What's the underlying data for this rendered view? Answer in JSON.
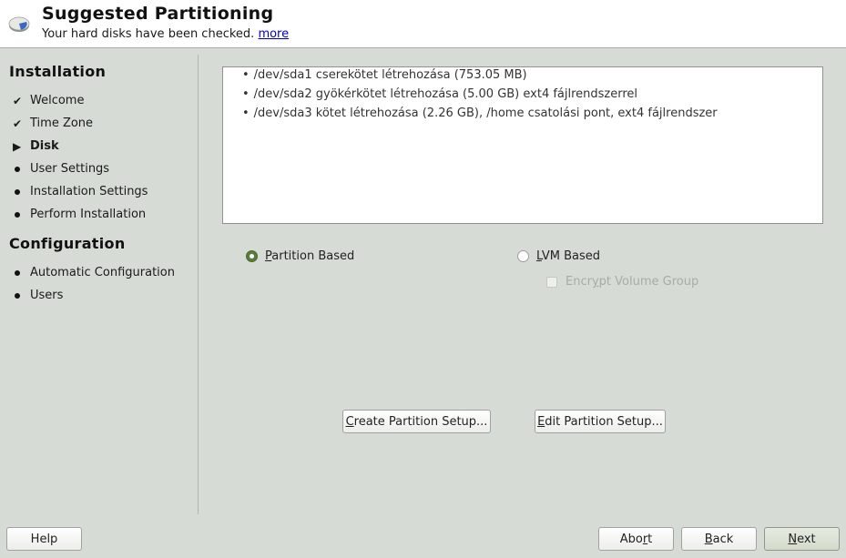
{
  "header": {
    "title": "Suggested Partitioning",
    "subtitle": "Your hard disks have been checked.",
    "more_link": "more",
    "icon": "hard-disk-icon"
  },
  "sidebar": {
    "sections": [
      {
        "title": "Installation",
        "items": [
          {
            "label": "Welcome",
            "state": "done",
            "icon": "check-icon"
          },
          {
            "label": "Time Zone",
            "state": "done",
            "icon": "check-icon"
          },
          {
            "label": "Disk",
            "state": "current",
            "icon": "arrow-right-icon"
          },
          {
            "label": "User Settings",
            "state": "pending",
            "icon": "bullet-icon"
          },
          {
            "label": "Installation Settings",
            "state": "pending",
            "icon": "bullet-icon"
          },
          {
            "label": "Perform Installation",
            "state": "pending",
            "icon": "bullet-icon"
          }
        ]
      },
      {
        "title": "Configuration",
        "items": [
          {
            "label": "Automatic Configuration",
            "state": "pending",
            "icon": "bullet-icon"
          },
          {
            "label": "Users",
            "state": "pending",
            "icon": "bullet-icon"
          }
        ]
      }
    ]
  },
  "glyphs": {
    "check": "✔",
    "arrow": "▶"
  },
  "summary": {
    "items": [
      "/dev/sda1 cserekötet létrehozása (753.05 MB)",
      "/dev/sda2 gyökérkötet létrehozása (5.00 GB) ext4 fájlrendszerrel",
      "/dev/sda3 kötet létrehozása (2.26 GB), /home csatolási pont, ext4 fájlrendszer"
    ]
  },
  "options": {
    "partition_based": {
      "mnemonic": "P",
      "rest": "artition Based",
      "checked": true
    },
    "lvm_based": {
      "mnemonic": "L",
      "rest": "VM Based",
      "checked": false
    },
    "encrypt": {
      "pre": "Encr",
      "mnemonic": "y",
      "rest": "pt Volume Group",
      "checked": false,
      "enabled": false
    }
  },
  "buttons": {
    "create": {
      "mnemonic": "C",
      "rest": "reate Partition Setup..."
    },
    "edit": {
      "mnemonic": "E",
      "rest": "dit Partition Setup..."
    },
    "help": {
      "label": "Help"
    },
    "abort": {
      "pre": "Abo",
      "mnemonic": "r",
      "rest": "t"
    },
    "back": {
      "mnemonic": "B",
      "rest": "ack"
    },
    "next": {
      "mnemonic": "N",
      "rest": "ext"
    }
  }
}
